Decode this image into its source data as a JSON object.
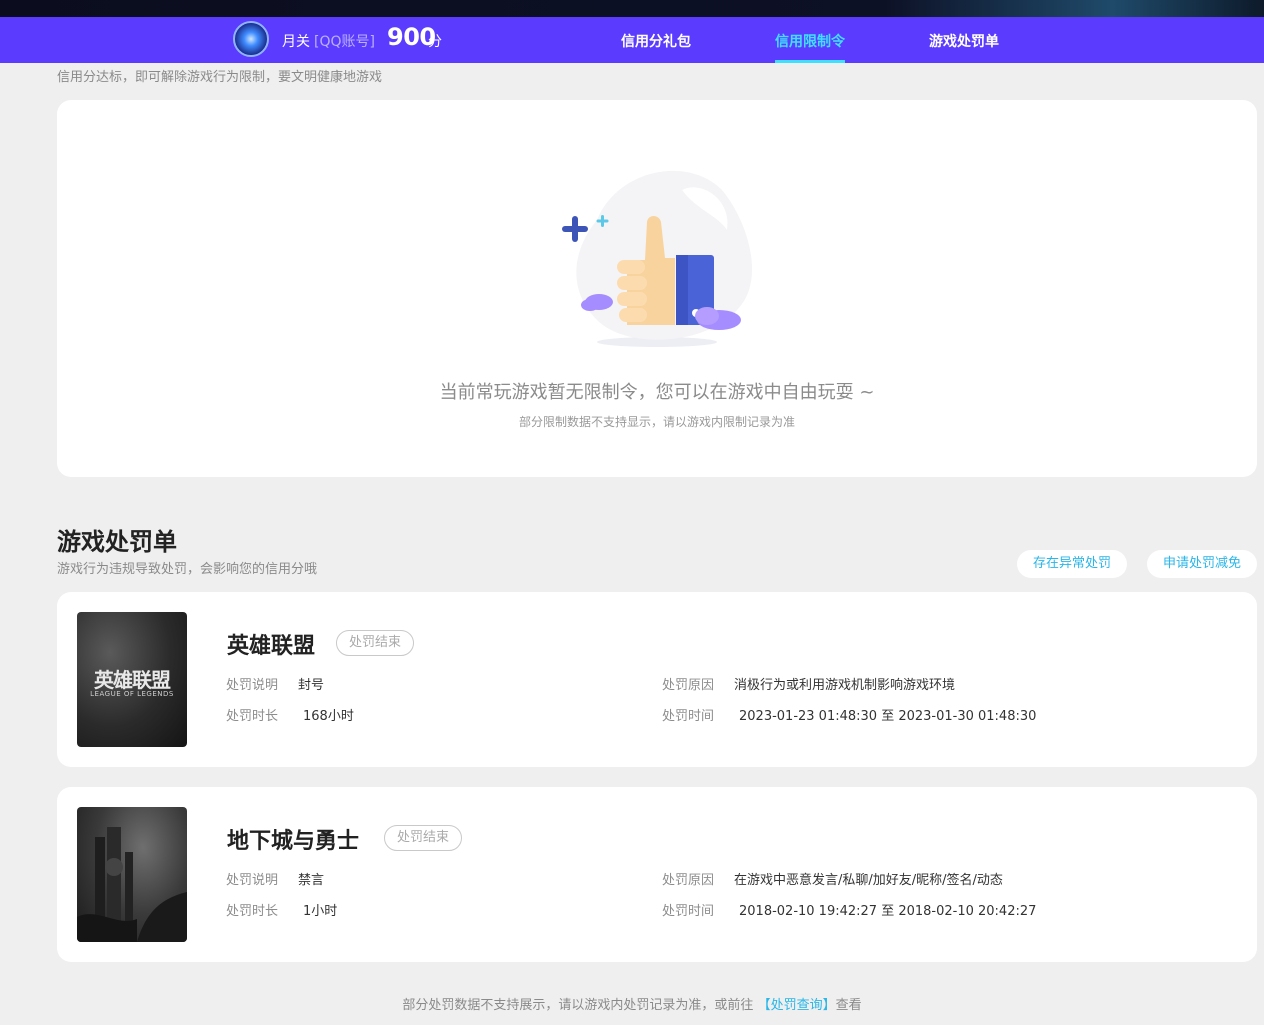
{
  "header": {
    "username": "月关",
    "account_type": "[QQ账号]",
    "score": "900",
    "score_unit": "分",
    "tabs": [
      {
        "label": "信用分礼包",
        "active": false
      },
      {
        "label": "信用限制令",
        "active": true
      },
      {
        "label": "游戏处罚单",
        "active": false
      }
    ],
    "accent_color": "#5b3cff",
    "active_tab_color": "#3fe0ff"
  },
  "restriction": {
    "hint": "信用分达标，即可解除游戏行为限制，要文明健康地游戏",
    "empty_title": "当前常玩游戏暂无限制令，您可以在游戏中自由玩耍 ~",
    "empty_sub": "部分限制数据不支持显示，请以游戏内限制记录为准",
    "illustration_icon": "thumbs-up-illustration"
  },
  "penalty": {
    "title": "游戏处罚单",
    "subtitle": "游戏行为违规导致处罚，会影响您的信用分哦",
    "buttons": {
      "abnormal": "存在异常处罚",
      "reduce": "申请处罚减免"
    },
    "labels": {
      "desc": "处罚说明",
      "duration": "处罚时长",
      "reason": "处罚原因",
      "time": "处罚时间"
    },
    "items": [
      {
        "game": "英雄联盟",
        "cover_text": "英雄联盟",
        "cover_sub": "LEAGUE OF LEGENDS",
        "status": "处罚结束",
        "desc": "封号",
        "duration": "168小时",
        "reason": "消极行为或利用游戏机制影响游戏环境",
        "time": "2023-01-23 01:48:30 至 2023-01-30 01:48:30"
      },
      {
        "game": "地下城与勇士",
        "status": "处罚结束",
        "desc": "禁言",
        "duration": "1小时",
        "reason": "在游戏中恶意发言/私聊/加好友/昵称/签名/动态",
        "time": "2018-02-10 19:42:27 至 2018-02-10 20:42:27"
      }
    ]
  },
  "footer": {
    "text_before": "部分处罚数据不支持展示，请以游戏内处罚记录为准，或前往",
    "link": "【处罚查询】",
    "text_after": "查看"
  }
}
